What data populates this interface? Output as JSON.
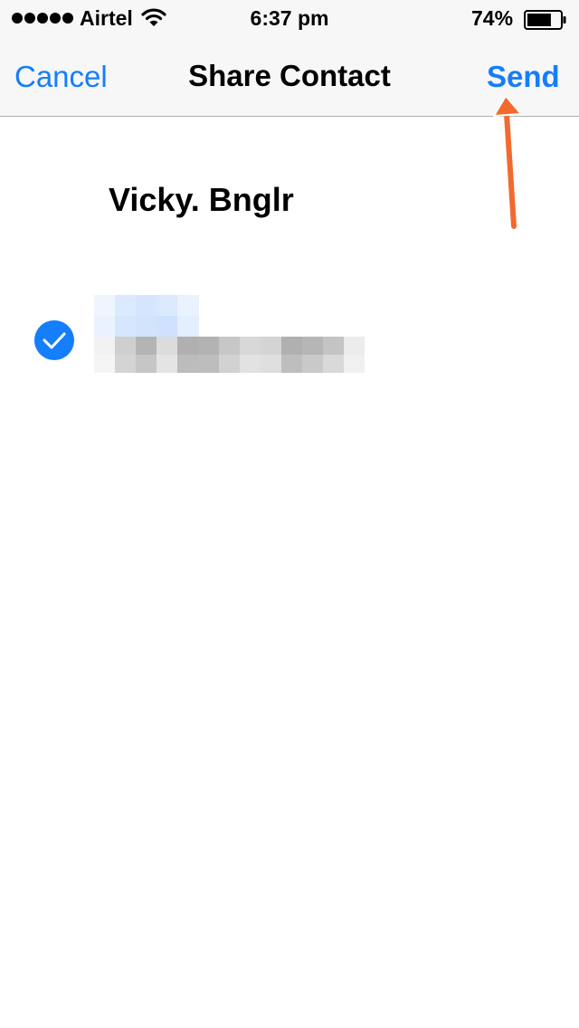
{
  "status_bar": {
    "carrier": "Airtel",
    "time": "6:37 pm",
    "battery_percent": "74%",
    "battery_level": 0.74,
    "signal_bars": 5
  },
  "nav": {
    "cancel_label": "Cancel",
    "title": "Share Contact",
    "send_label": "Send"
  },
  "contact": {
    "name": "Vicky. Bnglr",
    "selected": true
  },
  "colors": {
    "accent": "#157efb",
    "annotation_arrow": "#f26a2e"
  },
  "icons": {
    "wifi": "wifi-icon",
    "battery": "battery-icon",
    "check": "checkmark-icon",
    "arrow": "arrow-up-annotation"
  }
}
